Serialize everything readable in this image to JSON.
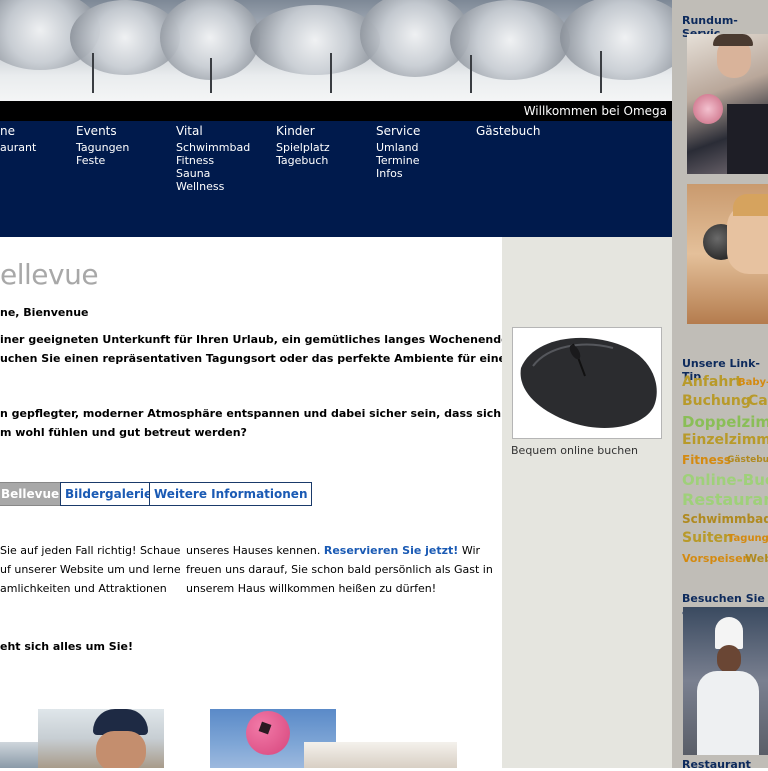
{
  "header": {
    "welcome": "Willkommen bei Omega"
  },
  "nav": [
    {
      "label": "ne",
      "items": [
        "aurant"
      ]
    },
    {
      "label": "Events",
      "items": [
        "Tagungen",
        "Feste"
      ]
    },
    {
      "label": "Vital",
      "items": [
        "Schwimmbad",
        "Fitness",
        "Sauna",
        "Wellness"
      ]
    },
    {
      "label": "Kinder",
      "items": [
        "Spielplatz",
        "Tagebuch"
      ]
    },
    {
      "label": "Service",
      "items": [
        "Umland",
        "Termine",
        "Infos"
      ]
    },
    {
      "label": "Gästebuch",
      "items": []
    }
  ],
  "main": {
    "title": "ellevue",
    "greeting": "ne, Bienvenue",
    "para1": [
      "iner geeigneten Unterkunft für Ihren Urlaub, ein gemütliches langes Wochenende oder",
      "uchen Sie einen repräsentativen Tagungsort oder das perfekte Ambiente für eine"
    ],
    "para2": [
      "n gepflegter, moderner Atmosphäre entspannen und dabei sicher sein, dass sich auch",
      "m wohl fühlen und gut betreut werden?"
    ],
    "tabs": [
      "Bellevue",
      "Bildergalerie",
      "Weitere Informationen"
    ],
    "col1": [
      " Sie auf jeden Fall richtig! Schauen",
      "uf unserer Website um und lernen",
      "amlichkeiten und Attraktionen"
    ],
    "col2_line1": "unseres Hauses kennen.",
    "col2_link": "Reservieren Sie jetzt!",
    "col2_line1_end": " Wir",
    "col2": [
      "freuen uns darauf, Sie schon bald persönlich als Gast in",
      "unserem Haus willkommen heißen zu dürfen!"
    ],
    "tagline": "eht sich alles um Sie!"
  },
  "promo": {
    "caption": "Bequem online buchen"
  },
  "right": {
    "service_heading": "Rundum-Servic",
    "links_heading": "Unsere Link-Tip",
    "tags": [
      {
        "text": "Anfahrt",
        "color": "#b89a2a"
      },
      {
        "text": "Baby-",
        "color": "#d48a10"
      },
      {
        "text": "Buchung",
        "color": "#b89a2a"
      },
      {
        "text": "Ca",
        "color": "#b89a2a"
      },
      {
        "text": "Doppelzimm",
        "color": "#8abe57"
      },
      {
        "text": "Einzelzimmer",
        "color": "#b89a2a"
      },
      {
        "text": "Fitness",
        "color": "#d48a10"
      },
      {
        "text": "Gästebuch",
        "color": "#b08a20"
      },
      {
        "text": "Online-Buch",
        "color": "#9fd07a"
      },
      {
        "text": "Restaurant",
        "color": "#9fd07a"
      },
      {
        "text": "Schwimmbad",
        "color": "#b08a20"
      },
      {
        "text": "Suiten",
        "color": "#b89a2a"
      },
      {
        "text": "Tagung",
        "color": "#d48a10"
      },
      {
        "text": "Vorspeisen",
        "color": "#d48a10"
      },
      {
        "text": "Web",
        "color": "#b08a20"
      }
    ],
    "visit_heading": "Besuchen Sie a",
    "restaurant_label": "Restaurant"
  }
}
